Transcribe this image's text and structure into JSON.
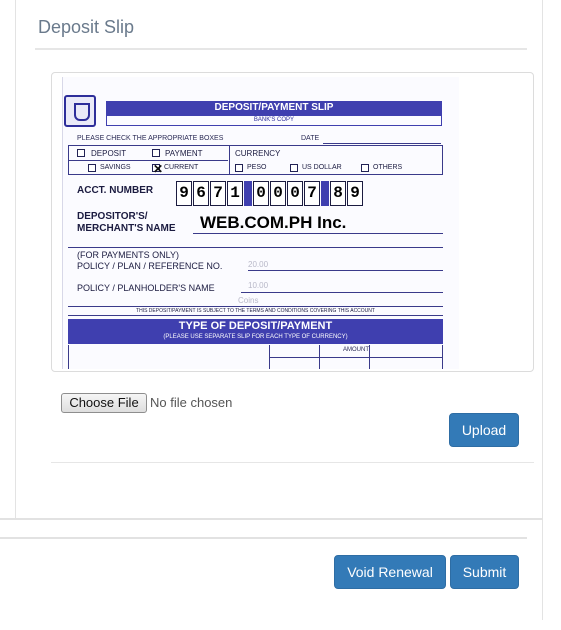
{
  "panel": {
    "title": "Deposit Slip"
  },
  "slip": {
    "header": "DEPOSIT/PAYMENT SLIP",
    "subheader": "BANK'S COPY",
    "check_instruction": "PLEASE CHECK THE APPROPRIATE BOXES",
    "date_label": "DATE",
    "deposit_label": "DEPOSIT",
    "payment_label": "PAYMENT",
    "currency_label": "CURRENCY",
    "savings_label": "SAVINGS",
    "current_label": "CURRENT",
    "peso_label": "PESO",
    "usd_label": "US DOLLAR",
    "others_label": "OTHERS",
    "acct_label": "ACCT. NUMBER",
    "acct_digits": [
      "9",
      "6",
      "7",
      "1",
      "0",
      "0",
      "0",
      "7",
      "8",
      "9"
    ],
    "depositor_label_1": "DEPOSITOR'S/",
    "depositor_label_2": "MERCHANT'S NAME",
    "merchant_name": "WEB.COM.PH Inc.",
    "for_payments": "(FOR PAYMENTS ONLY)",
    "policy_plan": "POLICY / PLAN / REFERENCE NO.",
    "policy_holder": "POLICY / PLANHOLDER'S NAME",
    "terms_text": "THIS DEPOSIT/PAYMENT IS SUBJECT TO THE TERMS AND CONDITIONS COVERING THIS ACCOUNT",
    "type_title": "TYPE OF DEPOSIT/PAYMENT",
    "type_sub": "(PLEASE USE SEPARATE SLIP FOR EACH TYPE OF CURRENCY)",
    "amount_label": "AMOUNT",
    "ghost_1": "20.00",
    "ghost_2": "10.00",
    "ghost_3": "Coins"
  },
  "file_input": {
    "button_label": "Choose File",
    "status": "No file chosen"
  },
  "buttons": {
    "upload": "Upload",
    "void_renewal": "Void Renewal",
    "submit": "Submit"
  },
  "colors": {
    "primary": "#337ab7",
    "slip_blue": "#3f3faf",
    "title_gray": "#6a7a8c"
  }
}
